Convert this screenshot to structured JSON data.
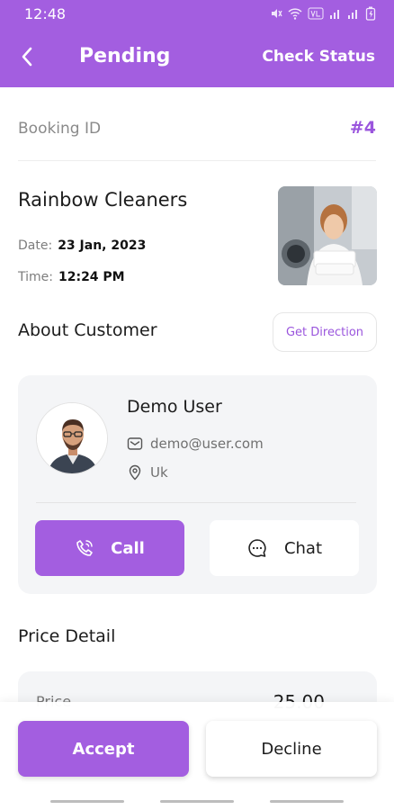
{
  "status_bar": {
    "time": "12:48",
    "icons": [
      "mute-icon",
      "wifi-icon",
      "volte-icon",
      "signal-icon",
      "signal-icon",
      "battery-icon"
    ]
  },
  "header": {
    "title": "Pending",
    "action": "Check Status",
    "back_icon": "chevron-left-icon"
  },
  "booking": {
    "label": "Booking ID",
    "id": "#4",
    "service_name": "Rainbow Cleaners",
    "date_label": "Date:",
    "date_value": "23 Jan, 2023",
    "time_label": "Time:",
    "time_value": "12:24 PM"
  },
  "customer": {
    "section_title": "About Customer",
    "direction_button": "Get Direction",
    "name": "Demo User",
    "email": "demo@user.com",
    "location": "Uk",
    "call_label": "Call",
    "chat_label": "Chat"
  },
  "price": {
    "section_title": "Price Detail",
    "label": "Price",
    "value": "25.00"
  },
  "actions": {
    "accept": "Accept",
    "decline": "Decline"
  },
  "colors": {
    "primary": "#a35ee0",
    "accent_text": "#9a55dd",
    "card_bg": "#f4f5f7"
  }
}
